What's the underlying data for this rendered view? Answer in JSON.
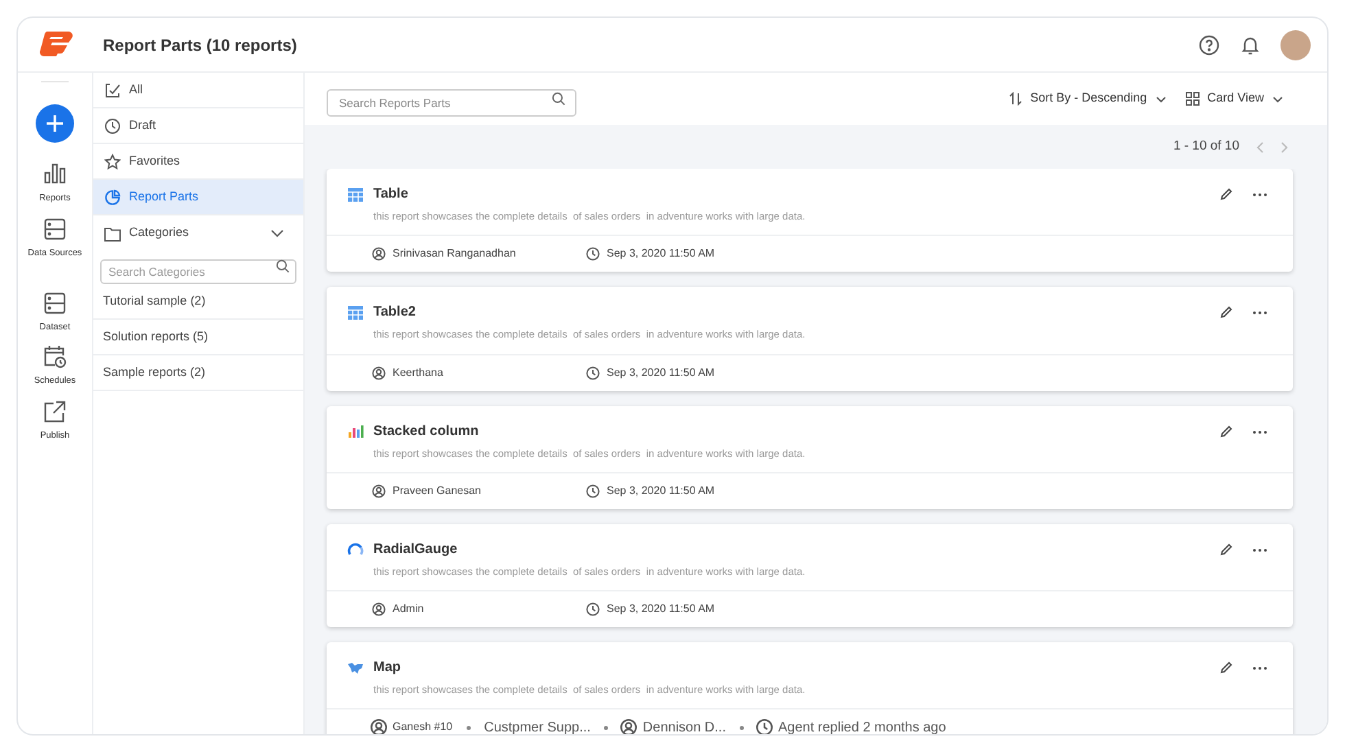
{
  "header": {
    "title": "Report Parts (10 reports)"
  },
  "rail": [
    {
      "label": "Reports",
      "kind": "bars"
    },
    {
      "label": "Data Sources",
      "kind": "db"
    },
    {
      "label": "Dataset",
      "kind": "db"
    },
    {
      "label": "Schedules",
      "kind": "calendar"
    },
    {
      "label": "Publish",
      "kind": "share"
    }
  ],
  "nav": [
    {
      "label": "All",
      "kind": "check",
      "selected": false
    },
    {
      "label": "Draft",
      "kind": "clock",
      "selected": false
    },
    {
      "label": "Favorites",
      "kind": "star",
      "selected": false
    },
    {
      "label": "Report Parts",
      "kind": "pie",
      "selected": true
    }
  ],
  "categories": {
    "label": "Categories",
    "expanded": true,
    "search_placeholder": "Search Categories",
    "items": [
      "Tutorial sample (2)",
      "Solution reports (5)",
      "Sample reports (2)"
    ]
  },
  "toolbar": {
    "search_placeholder": "Search Reports Parts",
    "sort": "Sort By - Descending",
    "view": "Card View"
  },
  "pagination": "1 - 10 of 10",
  "cards": [
    {
      "title": "Table",
      "kind": "table",
      "description": "this report showcases the complete details  of sales orders  in adventure works with large data.",
      "meta": [
        {
          "kind": "user",
          "text": "Srinivasan Ranganadhan"
        },
        {
          "kind": "clock",
          "text": "Sep 3, 2020 11:50 AM"
        }
      ]
    },
    {
      "title": "Table2",
      "kind": "table",
      "description": "this report showcases the complete details  of sales orders  in adventure works with large data.",
      "meta": [
        {
          "kind": "user",
          "text": "Keerthana"
        },
        {
          "kind": "clock",
          "text": "Sep 3, 2020 11:50 AM"
        }
      ]
    },
    {
      "title": "Stacked column",
      "kind": "chart",
      "description": "this report showcases the complete details  of sales orders  in adventure works with large data.",
      "meta": [
        {
          "kind": "user",
          "text": "Praveen Ganesan"
        },
        {
          "kind": "clock",
          "text": "Sep 3, 2020 11:50 AM"
        }
      ]
    },
    {
      "title": "RadialGauge",
      "kind": "gauge",
      "description": "this report showcases the complete details  of sales orders  in adventure works with large data.",
      "meta": [
        {
          "kind": "user",
          "text": "Admin"
        },
        {
          "kind": "clock",
          "text": "Sep 3, 2020 11:50 AM"
        }
      ]
    },
    {
      "title": "Map",
      "kind": "map",
      "description": "this report showcases the complete details  of sales orders  in adventure works with large data.",
      "meta": [
        {
          "kind": "user",
          "text": "Ganesh #10"
        },
        {
          "kind": "text",
          "text": "Custpmer Supp..."
        },
        {
          "kind": "user",
          "text": "Dennison D..."
        },
        {
          "kind": "clock",
          "text": "Agent replied 2 months ago"
        }
      ]
    }
  ]
}
